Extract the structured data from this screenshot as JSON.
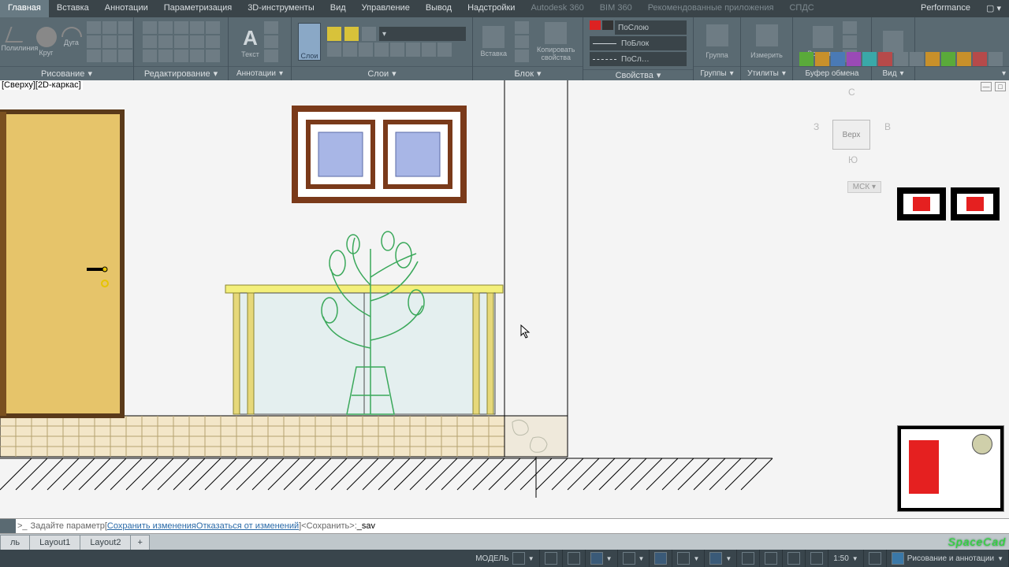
{
  "menu_tabs": {
    "main": "Главная",
    "insert": "Вставка",
    "annotate": "Аннотации",
    "param": "Параметризация",
    "tools3d": "3D-инструменты",
    "view": "Вид",
    "manage": "Управление",
    "output": "Вывод",
    "addins": "Надстройки",
    "a360": "Autodesk 360",
    "bim360": "BIM 360",
    "recommended": "Рекомендованные приложения",
    "express": "СПДС",
    "performance": "Performance"
  },
  "panels": {
    "draw": "Рисование",
    "edit": "Редактирование",
    "annot": "Аннотации",
    "layers": "Слои",
    "block": "Блок",
    "props": "Свойства",
    "groups": "Группы",
    "utils": "Утилиты",
    "clip": "Буфер обмена",
    "view": "Вид"
  },
  "draw_tools": {
    "polyline": "Полилиния",
    "circle": "Круг",
    "arc": "Дуга"
  },
  "layer_btn": "Слои",
  "block_tools": {
    "insert": "Вставка",
    "copy_props": "Копировать\nсвойства"
  },
  "props_combo": {
    "bylayer": "ПоСлою",
    "byblock": "ПоБлок",
    "bylayer2": "ПоСл…"
  },
  "groups_label": "Группа",
  "utils_label": "Измерить",
  "clip_label": "Вставить",
  "view_label": "[Сверху][2D-каркас]",
  "viewcube": {
    "face": "Верх",
    "n": "С",
    "s": "Ю",
    "e": "В",
    "w": "З",
    "ucs": "МСК"
  },
  "minmax": {
    "min": "—",
    "max": "□"
  },
  "cmd": {
    "prompt": "Задайте параметр ",
    "opt1": "Сохранить изменения",
    "opt2": "Отказаться от изменений",
    "default": " <Сохранить>: ",
    "typed": "_sav"
  },
  "layout_tabs": {
    "model": "ль",
    "l1": "Layout1",
    "l2": "Layout2",
    "add": "+"
  },
  "status": {
    "model": "МОДЕЛЬ",
    "scale": "1:50",
    "workspace": "Рисование и аннотации"
  },
  "brand": "SpaceCad"
}
